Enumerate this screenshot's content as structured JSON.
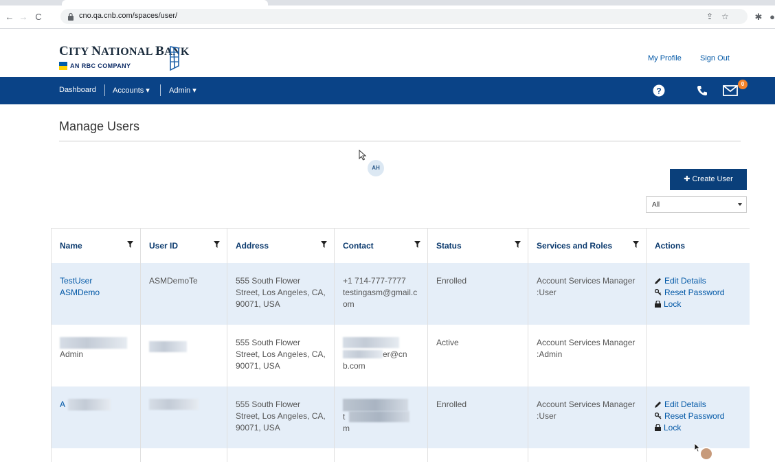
{
  "browser": {
    "url": "cno.qa.cnb.com/spaces/user/"
  },
  "header": {
    "bank_name_lead": "C",
    "bank_name_rest": "ITY ",
    "bank_name_lead2": "N",
    "bank_name_rest2": "ATIONAL ",
    "bank_name_lead3": "B",
    "bank_name_rest3": "ANK",
    "tagline": "AN RBC COMPANY",
    "my_profile": "My Profile",
    "sign_out": "Sign Out"
  },
  "nav": {
    "dashboard": "Dashboard",
    "accounts": "Accounts ▾",
    "admin": "Admin ▾",
    "message_count": "0"
  },
  "page": {
    "title": "Manage Users",
    "avatar_initials": "AH",
    "create_user": "✚ Create User",
    "filter_value": "All"
  },
  "table": {
    "headers": [
      "Name",
      "User ID",
      "Address",
      "Contact",
      "Status",
      "Services and Roles",
      "Actions"
    ],
    "rows": [
      {
        "name_line1": "TestUser",
        "name_line2": "ASMDemo",
        "user_id": "ASMDemoTe",
        "address": "555 South Flower Street, Los Angeles, CA, 90071, USA",
        "contact_line1": "+1 714-777-7777",
        "contact_line2": "testingasm@gmail.com",
        "status": "Enrolled",
        "services": "Account Services Manager :User",
        "actions": [
          "Edit Details",
          "Reset Password",
          "Lock"
        ]
      },
      {
        "name_line2": "Admin",
        "contact_tail": "er@cn",
        "contact_tail2": "b.com",
        "address": "555 South Flower Street, Los Angeles, CA, 90071, USA",
        "status": "Active",
        "services": "Account Services Manager :Admin"
      },
      {
        "name_initial": "A",
        "address": "555 South Flower Street, Los Angeles, CA, 90071, USA",
        "contact_head": "t",
        "contact_tail": "m",
        "status": "Enrolled",
        "services": "Account Services Manager :User",
        "actions": [
          "Edit Details",
          "Reset Password",
          "Lock"
        ]
      }
    ]
  },
  "colors": {
    "navbar": "#0a4387",
    "link": "#0057a6",
    "row_shade": "#e5eef8",
    "badge": "#f5832a"
  }
}
